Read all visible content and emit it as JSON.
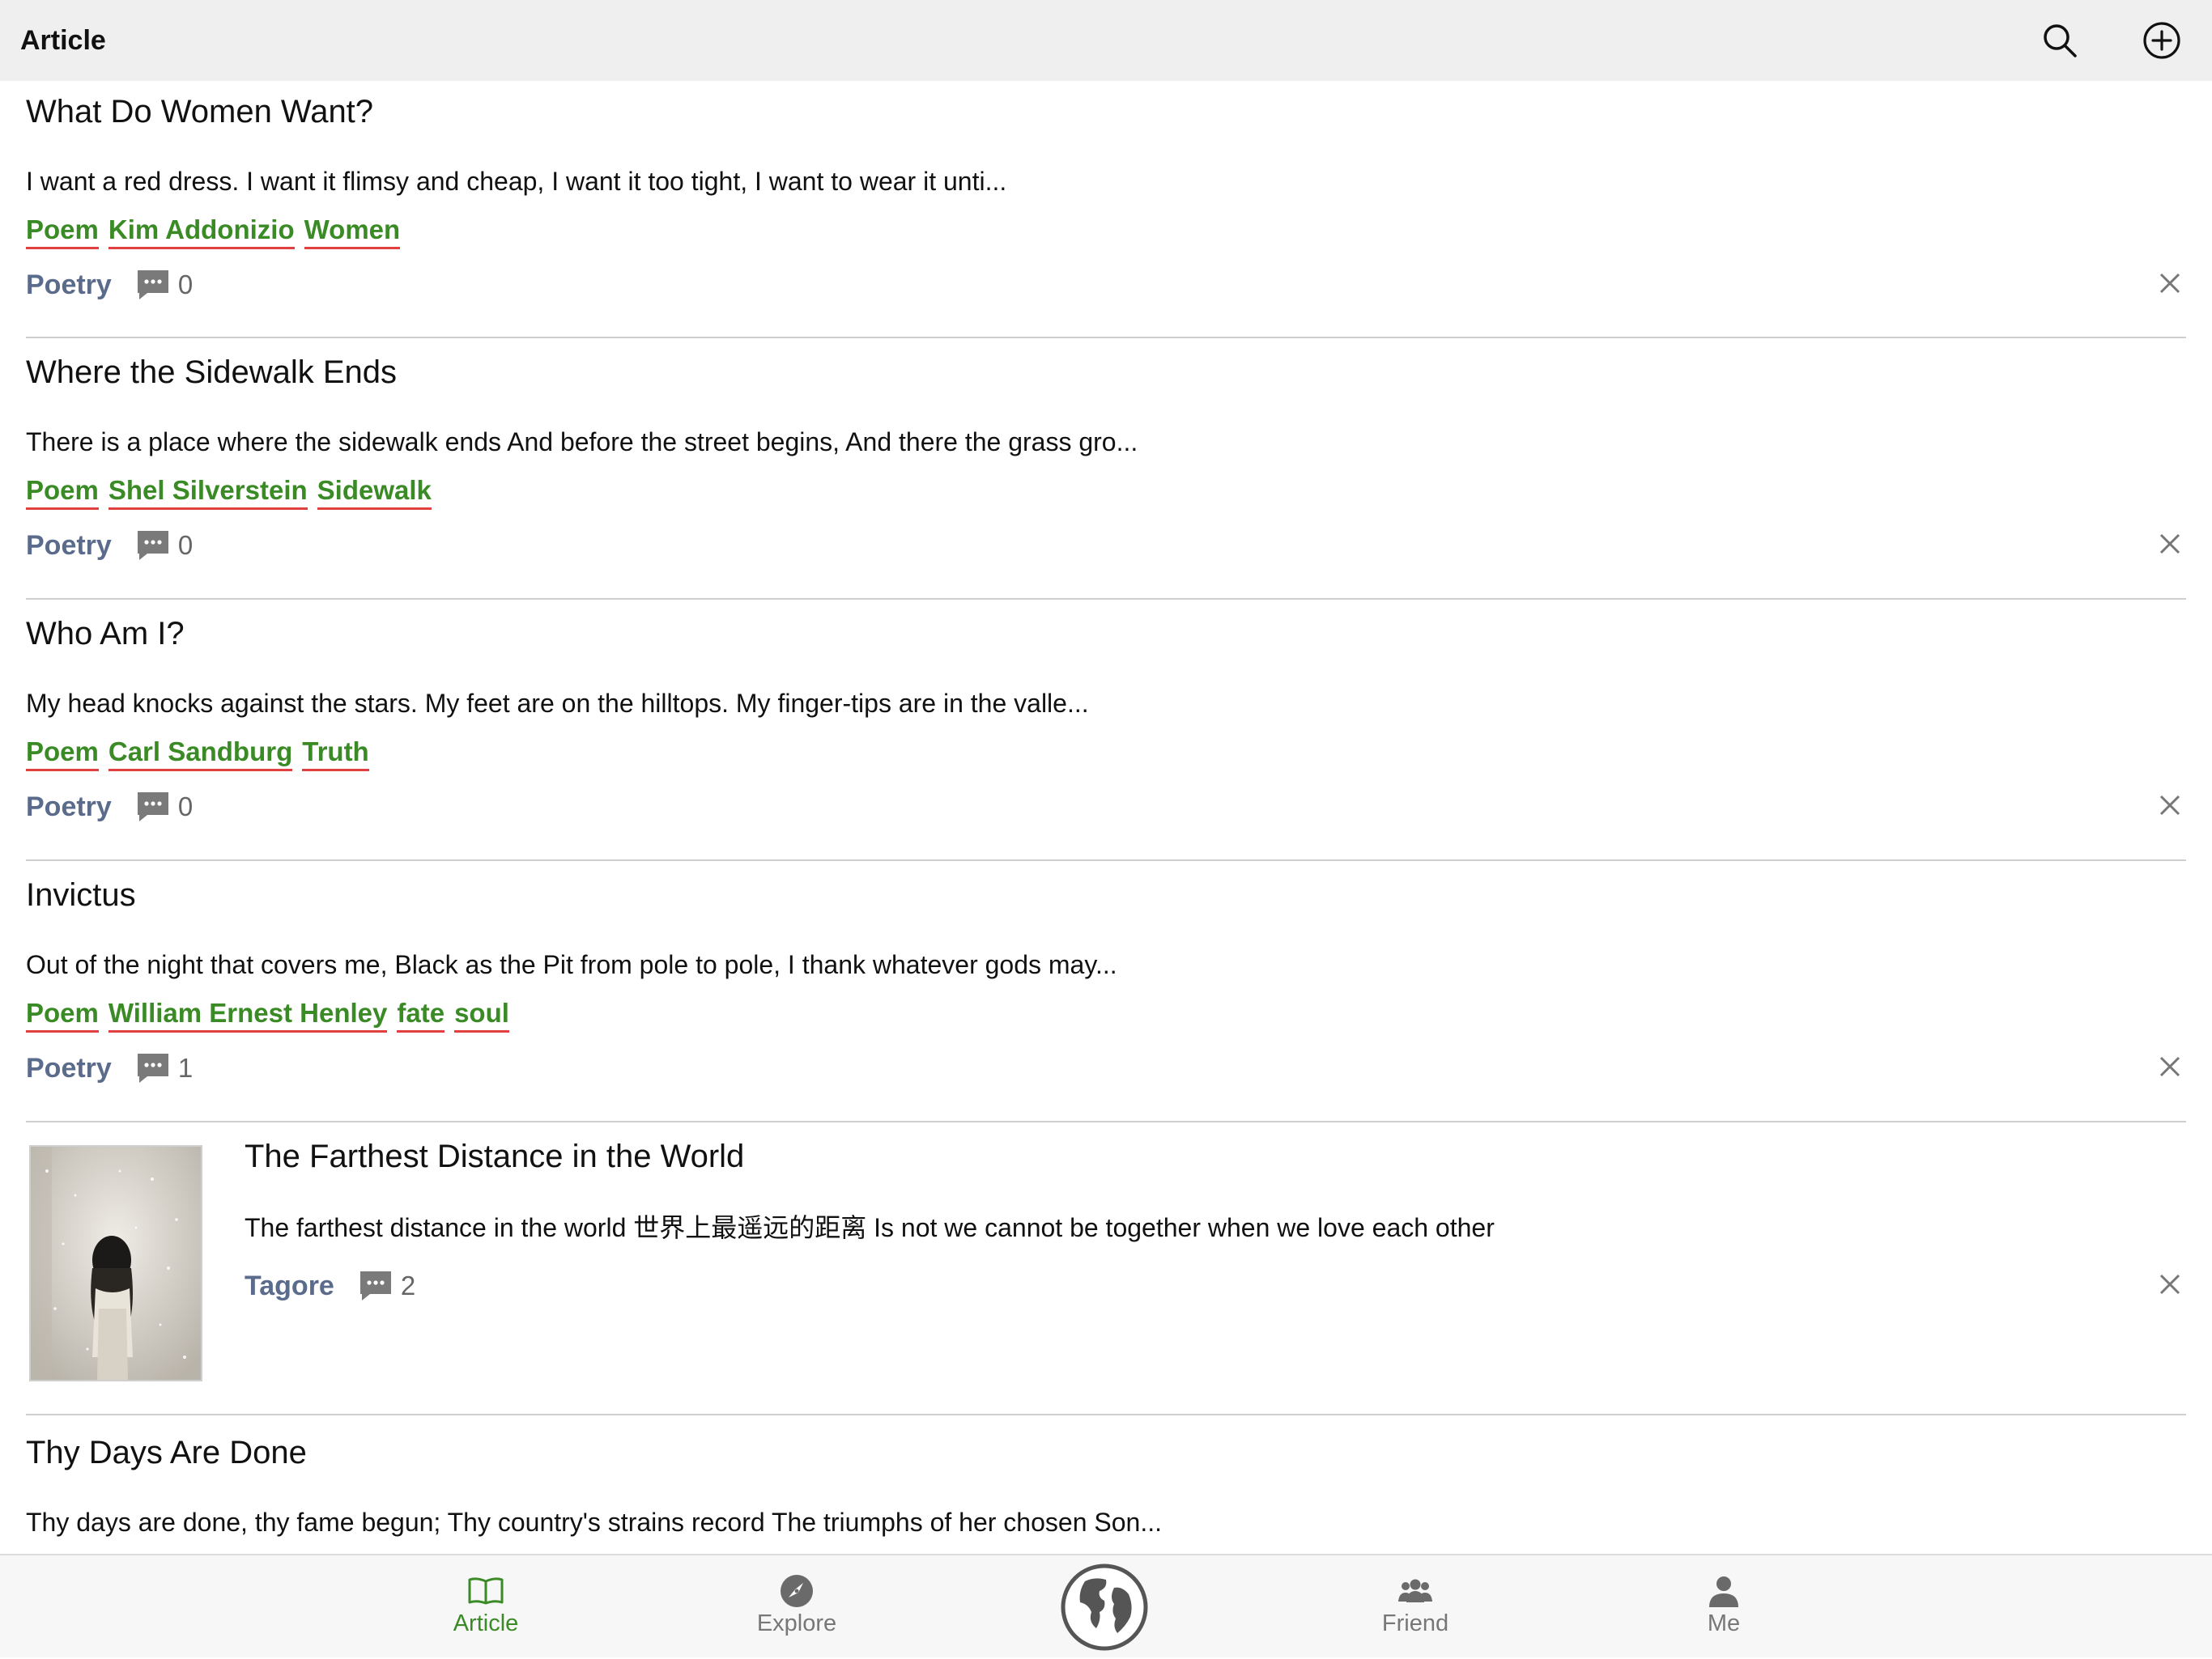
{
  "header": {
    "title": "Article"
  },
  "articles": [
    {
      "title": "What Do Women Want?",
      "excerpt": "I want a red dress. I want it flimsy and cheap, I want it too tight, I want to wear it unti...",
      "tags": [
        "Poem",
        "Kim Addonizio",
        "Women"
      ],
      "category": "Poetry",
      "comments": "0"
    },
    {
      "title": "Where the Sidewalk Ends",
      "excerpt": "There is a place where the sidewalk ends And before the street begins, And there the grass gro...",
      "tags": [
        "Poem",
        "Shel Silverstein",
        "Sidewalk"
      ],
      "category": "Poetry",
      "comments": "0"
    },
    {
      "title": "Who Am I?",
      "excerpt": "My head knocks against the stars. My feet are on the hilltops. My finger-tips are in the valle...",
      "tags": [
        "Poem",
        "Carl Sandburg",
        "Truth"
      ],
      "category": "Poetry",
      "comments": "0"
    },
    {
      "title": "Invictus",
      "excerpt": "Out of the night that covers me, Black as the Pit from pole to pole, I thank whatever gods may...",
      "tags": [
        "Poem",
        "William Ernest Henley",
        "fate",
        "soul"
      ],
      "category": "Poetry",
      "comments": "1"
    },
    {
      "title": "The Farthest Distance in the World",
      "excerpt": "The farthest distance in the world 世界上最遥远的距离 Is not we cannot be together when we love each other",
      "category": "Tagore",
      "comments": "2"
    },
    {
      "title": "Thy Days Are Done",
      "excerpt": "Thy days are done, thy fame begun; Thy country's strains record The triumphs of her chosen Son..."
    }
  ],
  "tabs": {
    "article": "Article",
    "explore": "Explore",
    "friend": "Friend",
    "me": "Me"
  },
  "icons": {
    "search": "search-icon",
    "add": "plus-circle-icon",
    "comment": "comment-icon",
    "close": "close-icon",
    "article": "book-icon",
    "explore": "compass-icon",
    "globe": "globe-icon",
    "friend": "people-icon",
    "me": "person-icon"
  },
  "colors": {
    "tag": "#3a8a25",
    "tag_underline": "#e04040",
    "category": "#5a6b8c",
    "active_tab": "#3a8a25",
    "topbar_bg": "#efefef"
  }
}
